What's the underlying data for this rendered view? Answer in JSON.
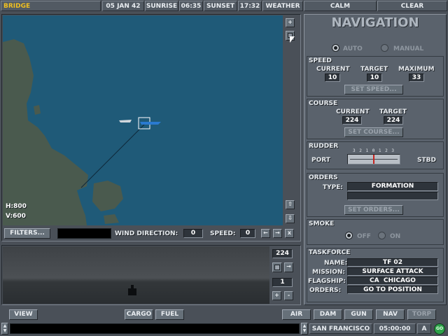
{
  "topbar": {
    "title": "BRIDGE",
    "date": "05 JAN 42",
    "sunrise_label": "SUNRISE",
    "sunrise_time": "06:35",
    "sunset_label": "SUNSET",
    "sunset_time": "17:32",
    "weather_label": "WEATHER",
    "sea_state": "CALM",
    "sky": "CLEAR"
  },
  "map": {
    "h_readout": "H:800",
    "v_readout": "V:600",
    "filters_label": "FILTERS...",
    "wind_direction_label": "WIND DIRECTION:",
    "wind_direction_value": "0",
    "speed_label": "SPEED:",
    "speed_value": "0",
    "zoom_in_symbol": "+",
    "scroll_up_symbol": "⇧",
    "scroll_down_symbol": "⇩",
    "close_symbol": "x",
    "prev_symbol": "←",
    "next_symbol": "→",
    "colors": {
      "sea": "#1f5a78",
      "land": "#4a5a4e",
      "course_line": "#10283a",
      "selection": "#ffffff"
    }
  },
  "view": {
    "heading": "224",
    "zoom": "1",
    "plus": "+",
    "minus": "-"
  },
  "navigation": {
    "title": "NAVIGATION",
    "mode": {
      "auto": "AUTO",
      "manual": "MANUAL",
      "selected": "auto"
    },
    "speed": {
      "title": "SPEED",
      "current_label": "CURRENT",
      "target_label": "TARGET",
      "maximum_label": "MAXIMUM",
      "current": "10",
      "target": "10",
      "maximum": "33",
      "set_label": "SET SPEED..."
    },
    "course": {
      "title": "COURSE",
      "current_label": "CURRENT",
      "target_label": "TARGET",
      "current": "224",
      "target": "224",
      "set_label": "SET COURSE..."
    },
    "rudder": {
      "title": "RUDDER",
      "port": "PORT",
      "stbd": "STBD",
      "scale": "3 2 1 0 1 2 3",
      "position": 0
    },
    "orders": {
      "title": "ORDERS",
      "type_label": "TYPE:",
      "type_value": "FORMATION",
      "set_label": "SET ORDERS..."
    },
    "smoke": {
      "title": "SMOKE",
      "off": "OFF",
      "on": "ON",
      "selected": "off"
    },
    "taskforce": {
      "title": "TASKFORCE",
      "name_label": "NAME:",
      "name": "TF 02",
      "mission_label": "MISSION:",
      "mission": "SURFACE ATTACK",
      "flagship_label": "FLAGSHIP:",
      "flagship": "CA  CHICAGO",
      "orders_label": "ORDERS:",
      "orders": "GO TO POSITION"
    }
  },
  "bottombar": {
    "view": "VIEW",
    "cargo": "CARGO",
    "fuel": "FUEL",
    "air": "AIR",
    "dam": "DAM",
    "gun": "GUN",
    "nav": "NAV",
    "torp": "TORP"
  },
  "status": {
    "location": "SAN FRANCISCO",
    "time": "05:00:00",
    "mode_letter": "A",
    "go": "GO"
  }
}
